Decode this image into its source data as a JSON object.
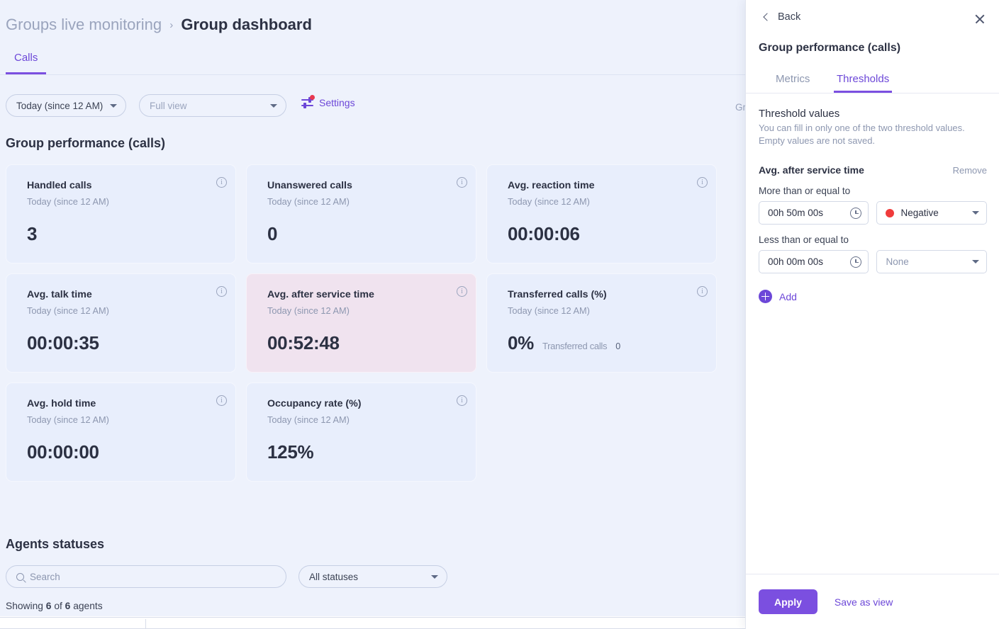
{
  "breadcrumb": {
    "parent": "Groups live monitoring",
    "separator": "›",
    "current": "Group dashboard"
  },
  "tabs": {
    "calls": "Calls"
  },
  "toolbar": {
    "date_filter": "Today (since 12 AM)",
    "view_filter": "Full view",
    "settings_label": "Settings",
    "right_truncated": "Gr"
  },
  "sections": {
    "group_performance_title": "Group performance (calls)",
    "agents_statuses_title": "Agents statuses"
  },
  "cards": [
    {
      "title": "Handled calls",
      "sub": "Today (since 12 AM)",
      "value": "3",
      "alert": false
    },
    {
      "title": "Unanswered calls",
      "sub": "Today (since 12 AM)",
      "value": "0",
      "alert": false
    },
    {
      "title": "Avg. reaction time",
      "sub": "Today (since 12 AM)",
      "value": "00:00:06",
      "alert": false
    },
    {
      "title": "Avg. talk time",
      "sub": "Today (since 12 AM)",
      "value": "00:00:35",
      "alert": false
    },
    {
      "title": "Avg. after service time",
      "sub": "Today (since 12 AM)",
      "value": "00:52:48",
      "alert": true
    },
    {
      "title": "Transferred calls (%)",
      "sub": "Today (since 12 AM)",
      "value": "0%",
      "value_sub_label": "Transferred calls",
      "value_sub_num": "0",
      "alert": false
    },
    {
      "title": "Avg. hold time",
      "sub": "Today (since 12 AM)",
      "value": "00:00:00",
      "alert": false
    },
    {
      "title": "Occupancy rate (%)",
      "sub": "Today (since 12 AM)",
      "value": "125%",
      "alert": false
    }
  ],
  "agents": {
    "search_placeholder": "Search",
    "status_filter": "All statuses",
    "showing_prefix": "Showing",
    "showing_count": "6",
    "showing_mid": "of",
    "showing_total": "6",
    "showing_suffix": "agents"
  },
  "panel": {
    "back_label": "Back",
    "title": "Group performance (calls)",
    "tabs": {
      "metrics": "Metrics",
      "thresholds": "Thresholds"
    },
    "threshold_values_title": "Threshold values",
    "threshold_values_desc": "You can fill in only one of the two threshold values. Empty values are not saved.",
    "metric_name": "Avg. after service time",
    "remove_label": "Remove",
    "more_than_label": "More than or equal to",
    "more_than_value": "00h 50m 00s",
    "more_than_severity": "Negative",
    "more_than_severity_color": "#f03b3b",
    "less_than_label": "Less than or equal to",
    "less_than_value": "00h 00m 00s",
    "less_than_severity": "None",
    "add_label": "Add",
    "apply_label": "Apply",
    "save_as_view_label": "Save as view"
  },
  "theme": {
    "accent": "#7b4fe0",
    "accent_text": "#6c47d8",
    "canvas": "#eef2fc",
    "card_bg": "#e8eefc",
    "card_alert_bg": "#f0e3ef"
  }
}
